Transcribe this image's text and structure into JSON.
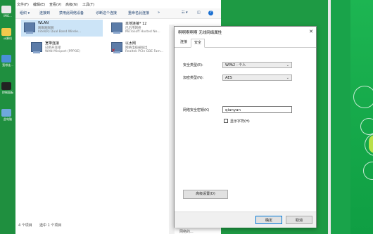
{
  "desktop": {
    "left_labels": [
      "IMG...",
      "计算机",
      "宽带连...",
      "控制面板",
      "远程...",
      "此电脑"
    ],
    "colors": {
      "green": "#1e9a44"
    }
  },
  "explorer": {
    "menu": [
      "文件(F)",
      "编辑(E)",
      "查看(V)",
      "高级(N)",
      "工具(T)"
    ],
    "toolbar": [
      "组织 ▾",
      "连接到",
      "禁用此网络设备",
      "诊断这个连接",
      "重命名此连接",
      "»"
    ],
    "connections": [
      {
        "name": "WLAN",
        "status": "啊啊啊啊啊",
        "adapter": "Intel(R) Dual Band Wirele..."
      },
      {
        "name": "本地连接* 12",
        "status": "已启用网络",
        "adapter": "Microsoft Hosted Ne..."
      },
      {
        "name": "宽带连接",
        "status": "已断开连接",
        "adapter": "WAN Miniport (PPPOE)"
      },
      {
        "name": "以太网",
        "status": "网络电缆被拔出",
        "adapter": "Realtek PCIe GBE Fam..."
      }
    ],
    "status": {
      "count": "4 个项目",
      "selected": "选中 1 个项目"
    }
  },
  "dialog": {
    "title": "啊啊啊啊啊 无线网络属性",
    "tabs": [
      "连接",
      "安全"
    ],
    "security_type_label": "安全类型(E):",
    "security_type_value": "WPA2 - 个人",
    "encryption_type_label": "加密类型(N):",
    "encryption_type_value": "AES",
    "key_label": "网络安全密钥(K)",
    "key_value": "qianyan",
    "show_chars": "显示字符(H)",
    "advanced": "高级设置(D)",
    "ok": "确定",
    "cancel": "取消"
  },
  "below_text": "网络的..."
}
